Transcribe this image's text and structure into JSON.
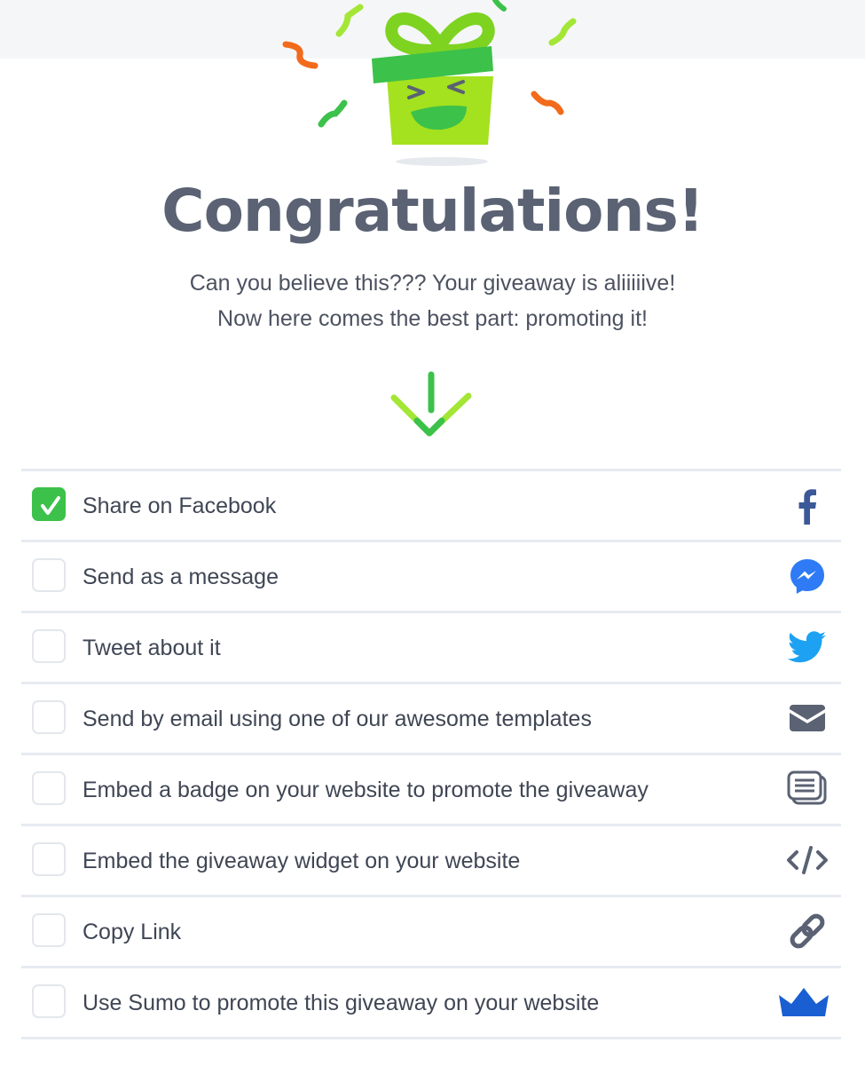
{
  "header": {
    "title": "Congratulations!",
    "subtitle_line1": "Can you believe this??? Your giveaway is aliiiiive!",
    "subtitle_line2": "Now here comes the best part: promoting it!"
  },
  "colors": {
    "accent_green": "#3cc14a",
    "title_gray": "#5a6273",
    "facebook": "#3b5998",
    "messenger": "#2f7bf5",
    "twitter": "#1da1f2",
    "sumo": "#1a5fd1"
  },
  "promote_options": [
    {
      "label": "Share on Facebook",
      "checked": true,
      "icon": "facebook-icon"
    },
    {
      "label": "Send as a message",
      "checked": false,
      "icon": "messenger-icon"
    },
    {
      "label": "Tweet about it",
      "checked": false,
      "icon": "twitter-icon"
    },
    {
      "label": "Send by email using one of our awesome templates",
      "checked": false,
      "icon": "envelope-icon"
    },
    {
      "label": "Embed a badge on your website to promote the giveaway",
      "checked": false,
      "icon": "badge-icon"
    },
    {
      "label": "Embed the giveaway widget on your website",
      "checked": false,
      "icon": "code-icon"
    },
    {
      "label": "Copy Link",
      "checked": false,
      "icon": "link-icon"
    },
    {
      "label": "Use Sumo to promote this giveaway on your website",
      "checked": false,
      "icon": "sumo-crown-icon"
    }
  ]
}
